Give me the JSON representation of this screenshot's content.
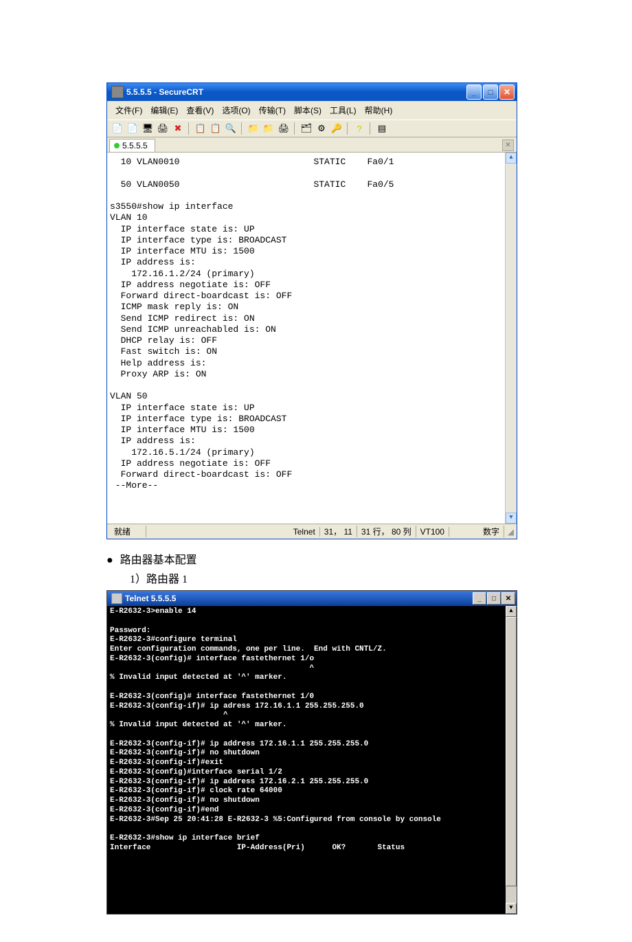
{
  "crt": {
    "title": "5.5.5.5 - SecureCRT",
    "menus": {
      "file": "文件(F)",
      "edit": "编辑(E)",
      "view": "查看(V)",
      "options": "选项(O)",
      "transfer": "传输(T)",
      "script": "脚本(S)",
      "tools": "工具(L)",
      "help": "帮助(H)"
    },
    "tab": "5.5.5.5",
    "terminal": "  10 VLAN0010                         STATIC    Fa0/1\n\n  50 VLAN0050                         STATIC    Fa0/5\n\ns3550#show ip interface\nVLAN 10\n  IP interface state is: UP\n  IP interface type is: BROADCAST\n  IP interface MTU is: 1500\n  IP address is:\n    172.16.1.2/24 (primary)\n  IP address negotiate is: OFF\n  Forward direct-boardcast is: OFF\n  ICMP mask reply is: ON\n  Send ICMP redirect is: ON\n  Send ICMP unreachabled is: ON\n  DHCP relay is: OFF\n  Fast switch is: ON\n  Help address is:\n  Proxy ARP is: ON\n\nVLAN 50\n  IP interface state is: UP\n  IP interface type is: BROADCAST\n  IP interface MTU is: 1500\n  IP address is:\n    172.16.5.1/24 (primary)\n  IP address negotiate is: OFF\n  Forward direct-boardcast is: OFF\n --More--",
    "status": {
      "ready": "就绪",
      "proto": "Telnet",
      "pos": "31， 11",
      "rows": "31 行， 80 列",
      "term": "VT100",
      "ins": "数字"
    }
  },
  "doc": {
    "bullet": "路由器基本配置",
    "num": "1）路由器 1"
  },
  "tel": {
    "title": "Telnet 5.5.5.5",
    "body": "E-R2632-3>enable 14\n\nPassword:\nE-R2632-3#configure terminal\nEnter configuration commands, one per line.  End with CNTL/Z.\nE-R2632-3(config)# interface fastethernet 1/o\n                                            ^\n% Invalid input detected at '^' marker.\n\nE-R2632-3(config)# interface fastethernet 1/0\nE-R2632-3(config-if)# ip adress 172.16.1.1 255.255.255.0\n                         ^\n% Invalid input detected at '^' marker.\n\nE-R2632-3(config-if)# ip address 172.16.1.1 255.255.255.0\nE-R2632-3(config-if)# no shutdown\nE-R2632-3(config-if)#exit\nE-R2632-3(config)#interface serial 1/2\nE-R2632-3(config-if)# ip address 172.16.2.1 255.255.255.0\nE-R2632-3(config-if)# clock rate 64000\nE-R2632-3(config-if)# no shutdown\nE-R2632-3(config-if)#end\nE-R2632-3#Sep 25 20:41:28 E-R2632-3 %5:Configured from console by console\n\nE-R2632-3#show ip interface brief\nInterface                   IP-Address(Pri)      OK?       Status"
  }
}
